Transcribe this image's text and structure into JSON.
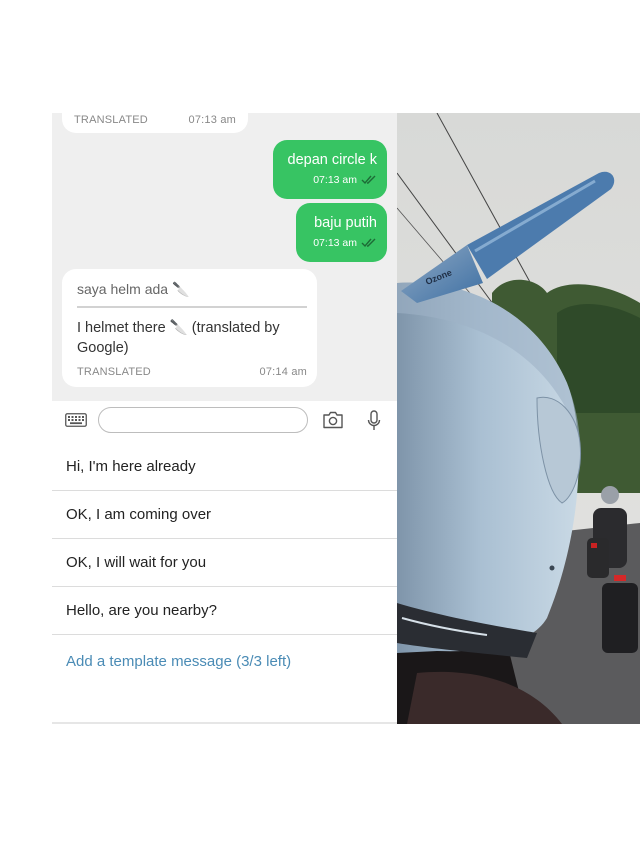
{
  "chat": {
    "top_bubble": {
      "label": "TRANSLATED",
      "time": "07:13 am"
    },
    "outgoing": [
      {
        "text": "depan circle k",
        "time": "07:13 am"
      },
      {
        "text": "baju putih",
        "time": "07:13 am"
      }
    ],
    "incoming": {
      "original": "saya helm ada 🔪",
      "translated": "I helmet there 🔪 (translated by Google)",
      "label": "TRANSLATED",
      "time": "07:14 am"
    }
  },
  "input": {
    "value": "",
    "placeholder": ""
  },
  "icons": {
    "keyboard": "keyboard-icon",
    "camera": "camera-icon",
    "mic": "microphone-icon"
  },
  "templates": [
    "Hi, I'm here already",
    "OK, I am coming over",
    "OK, I will wait for you",
    "Hello, are you nearby?"
  ],
  "add_template": "Add a template message (3/3 left)",
  "photo": {
    "knife_brand": "Ozone"
  },
  "colors": {
    "sent_bubble": "#37c463",
    "link": "#4a8bb5",
    "chat_bg": "#efefef"
  }
}
